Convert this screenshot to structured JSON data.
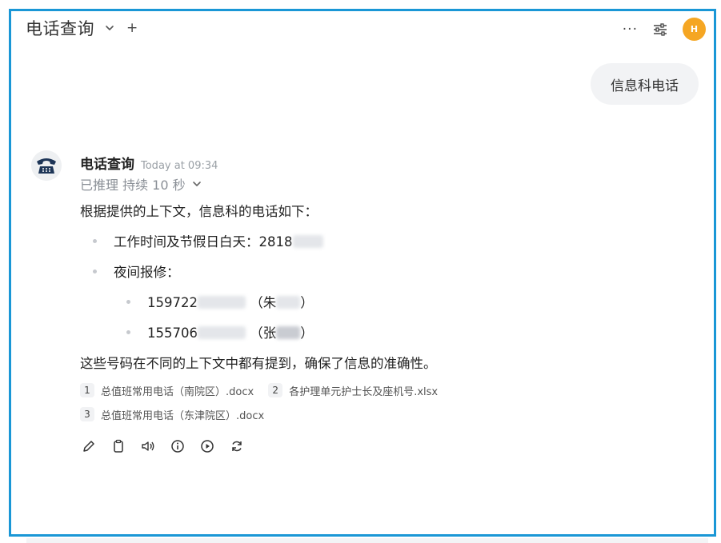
{
  "header": {
    "title": "电话查询",
    "chevron_icon": "chevron-down-icon",
    "new_chat_label": "+",
    "more_label": "···",
    "controls_icon": "sliders-icon",
    "avatar_initial": "H",
    "avatar_color": "#f5a623"
  },
  "user_message": "信息科电话",
  "assistant": {
    "name": "电话查询",
    "timestamp": "Today at 09:34",
    "reasoning_status": "已推理 持续 10 秒",
    "intro": "根据提供的上下文，信息科的电话如下：",
    "items": [
      {
        "prefix": "工作时间及节假日白天：2818",
        "redacted": true
      },
      {
        "prefix": "夜间报修：",
        "redacted": false
      }
    ],
    "sub_items": [
      {
        "number_prefix": "159722",
        "name_prefix": "（朱",
        "name_suffix": "）"
      },
      {
        "number_prefix": "155706",
        "name_prefix": "（张",
        "name_suffix": "）"
      }
    ],
    "summary": "这些号码在不同的上下文中都有提到，确保了信息的准确性。",
    "sources": [
      {
        "num": "1",
        "label": "总值班常用电话（南院区）.docx"
      },
      {
        "num": "2",
        "label": "各护理单元护士长及座机号.xlsx"
      },
      {
        "num": "3",
        "label": "总值班常用电话（东津院区）.docx"
      }
    ],
    "actions": [
      "edit-icon",
      "copy-icon",
      "speaker-icon",
      "info-icon",
      "play-icon",
      "regenerate-icon"
    ]
  },
  "colors": {
    "frame_border": "#1a97d6",
    "bubble_bg": "#f2f3f5",
    "muted_text": "#8a8f96"
  }
}
